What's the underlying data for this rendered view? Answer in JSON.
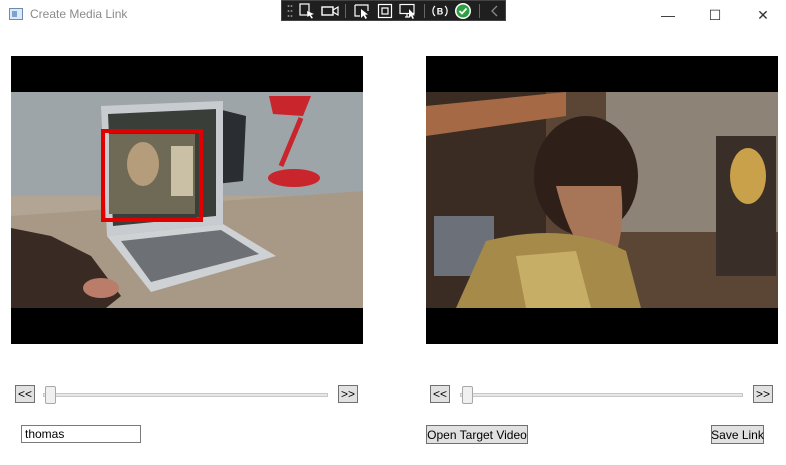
{
  "window": {
    "title": "Create Media Link",
    "minimize_glyph": "—",
    "maximize_glyph": "☐",
    "close_glyph": "✕"
  },
  "toolbar": {
    "icons": [
      "drag-handle-icon",
      "select-element-icon",
      "video-record-icon",
      "pointer-select-icon",
      "frame-select-icon",
      "display-select-icon",
      "track-focused-icon",
      "checkmark-circle-icon",
      "collapse-chevron-icon"
    ],
    "accent": "#2ea043"
  },
  "source_panel": {
    "prev_label": "<<",
    "next_label": ">>",
    "slider_value": 0.0,
    "name_value": "thomas",
    "highlight_color": "#e00000"
  },
  "target_panel": {
    "prev_label": "<<",
    "next_label": ">>",
    "slider_value": 0.0,
    "open_label": "Open Target Video",
    "save_label": "Save Link"
  }
}
